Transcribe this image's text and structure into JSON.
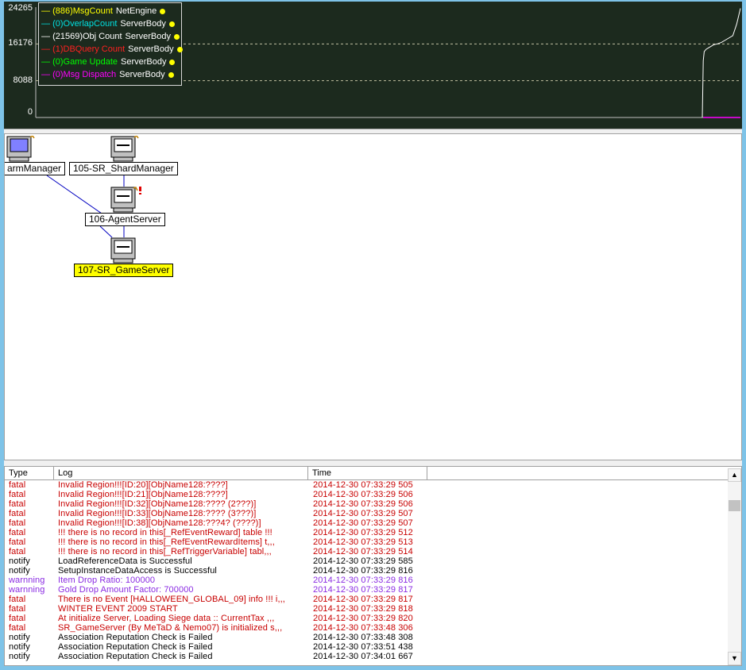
{
  "chart_data": {
    "type": "line",
    "yticks": [
      "24265",
      "16176",
      "8088",
      "0"
    ],
    "ylim": [
      0,
      24265
    ],
    "grid": "dashed horizontal",
    "legend": "top-left",
    "series": [
      {
        "label": "(886)MsgCount",
        "object": "NetEngine",
        "color": "#ffff00"
      },
      {
        "label": "(0)OverlapCount",
        "object": "ServerBody",
        "color": "#00e0e0"
      },
      {
        "label": "(21569)Obj Count",
        "object": "ServerBody",
        "color": "#ffffff"
      },
      {
        "label": "(1)DBQuery Count",
        "object": "ServerBody",
        "color": "#ff2020"
      },
      {
        "label": "(0)Game Update",
        "object": "ServerBody",
        "color": "#00ff00"
      },
      {
        "label": "(0)Msg Dispatch",
        "object": "ServerBody",
        "color": "#ff00ff"
      }
    ],
    "obj_count_trace": {
      "x": [
        0,
        0.5,
        1,
        2,
        4,
        6,
        8,
        10,
        12,
        14,
        16,
        18,
        20
      ],
      "y": [
        0,
        12500,
        14500,
        15000,
        15500,
        16000,
        16200,
        16500,
        17000,
        17500,
        18000,
        20500,
        24000
      ]
    }
  },
  "topology": {
    "nodes": [
      {
        "label": "armManager",
        "selected": false
      },
      {
        "label": "105-SR_ShardManager",
        "selected": false
      },
      {
        "label": "106-AgentServer",
        "selected": false
      },
      {
        "label": "107-SR_GameServer",
        "selected": true
      }
    ]
  },
  "log": {
    "columns": [
      "Type",
      "Log",
      "Time"
    ],
    "colors": {
      "fatal": "#c80000",
      "notify": "#000000",
      "warnning": "#8a2be2"
    },
    "rows": [
      {
        "type": "fatal",
        "msg": "Invalid Region!!![ID:20][ObjName128:????]",
        "time": "2014-12-30 07:33:29 505"
      },
      {
        "type": "fatal",
        "msg": "Invalid Region!!![ID:21][ObjName128:????]",
        "time": "2014-12-30 07:33:29 506"
      },
      {
        "type": "fatal",
        "msg": "Invalid Region!!![ID:32][ObjName128:???? (2???)]",
        "time": "2014-12-30 07:33:29 506"
      },
      {
        "type": "fatal",
        "msg": "Invalid Region!!![ID:33][ObjName128:???? (3???)]",
        "time": "2014-12-30 07:33:29 507"
      },
      {
        "type": "fatal",
        "msg": "Invalid Region!!![ID:38][ObjName128:???4? (????)]",
        "time": "2014-12-30 07:33:29 507"
      },
      {
        "type": "fatal",
        "msg": "!!! there is no record in this[_RefEventReward] table !!!",
        "time": "2014-12-30 07:33:29 512"
      },
      {
        "type": "fatal",
        "msg": "!!! there is no record in this[_RefEventRewardItems] t,,,",
        "time": "2014-12-30 07:33:29 513"
      },
      {
        "type": "fatal",
        "msg": "!!! there is no record in this[_RefTriggerVariable] tabl,,,",
        "time": "2014-12-30 07:33:29 514"
      },
      {
        "type": "notify",
        "msg": "LoadReferenceData is Successful",
        "time": "2014-12-30 07:33:29 585"
      },
      {
        "type": "notify",
        "msg": "SetupInstanceDataAccess is Successful",
        "time": "2014-12-30 07:33:29 816"
      },
      {
        "type": "warnning",
        "msg": "Item Drop Ratio: 100000",
        "time": "2014-12-30 07:33:29 816"
      },
      {
        "type": "warnning",
        "msg": "Gold Drop Amount Factor: 700000",
        "time": "2014-12-30 07:33:29 817"
      },
      {
        "type": "fatal",
        "msg": "There is no Event [HALLOWEEN_GLOBAL_09] info !!! i,,,",
        "time": "2014-12-30 07:33:29 817"
      },
      {
        "type": "fatal",
        "msg": "WINTER EVENT 2009 START",
        "time": "2014-12-30 07:33:29 818"
      },
      {
        "type": "fatal",
        "msg": "At initialize Server, Loading Siege data :: CurrentTax ,,,",
        "time": "2014-12-30 07:33:29 820"
      },
      {
        "type": "fatal",
        "msg": "SR_GameServer (By MeTaD & Nemo07) is initialized s,,,",
        "time": "2014-12-30 07:33:48 306"
      },
      {
        "type": "notify",
        "msg": "Association Reputation Check is Failed",
        "time": "2014-12-30 07:33:48 308"
      },
      {
        "type": "notify",
        "msg": "Association Reputation Check is Failed",
        "time": "2014-12-30 07:33:51 438"
      },
      {
        "type": "notify",
        "msg": "Association Reputation Check is Failed",
        "time": "2014-12-30 07:34:01 667"
      }
    ]
  }
}
